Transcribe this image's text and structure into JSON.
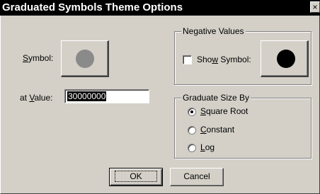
{
  "window": {
    "title": "Graduated Symbols Theme Options",
    "close_glyph": "×"
  },
  "symbol": {
    "label": "Symbol:",
    "swatch_color": "#8a8a8a",
    "icon": "gray-circle-icon"
  },
  "value": {
    "label": "at Value:",
    "input_value": "30000000"
  },
  "negative_values": {
    "group_title": "Negative Values",
    "show_symbol_label": "Show Symbol:",
    "show_symbol_checked": false,
    "swatch_color": "#000000",
    "icon": "black-circle-icon"
  },
  "graduate_size": {
    "group_title": "Graduate Size By",
    "options": [
      {
        "label": "Square Root",
        "checked": true
      },
      {
        "label": "Constant",
        "checked": false
      },
      {
        "label": "Log",
        "checked": false
      }
    ]
  },
  "buttons": {
    "ok": "OK",
    "cancel": "Cancel"
  }
}
